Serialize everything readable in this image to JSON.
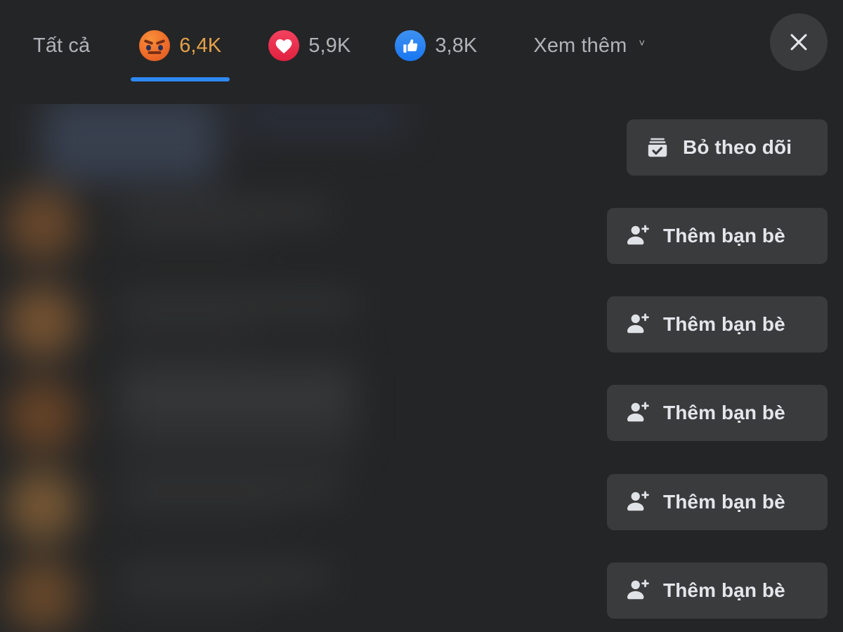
{
  "header": {
    "tabs": [
      {
        "label": "Tất cả",
        "icon": null,
        "active": false,
        "count": null
      },
      {
        "label": "6,4K",
        "icon": "angry-reaction-icon",
        "active": true,
        "count": "6,4K"
      },
      {
        "label": "5,9K",
        "icon": "love-reaction-icon",
        "active": false,
        "count": "5,9K"
      },
      {
        "label": "3,8K",
        "icon": "like-reaction-icon",
        "active": false,
        "count": "3,8K"
      },
      {
        "label": "Xem thêm",
        "icon": "chevron-down-icon",
        "active": false,
        "count": null
      }
    ],
    "more_caret": "˅",
    "close_label": "×",
    "active_tab_color": "#e4a24a",
    "underline_color": "#2e89f5",
    "inactive_tab_color": "#b0b3b8"
  },
  "actions": [
    {
      "label": "Bỏ theo dõi",
      "icon": "unfollow-feed-check-icon"
    },
    {
      "label": "Thêm bạn bè",
      "icon": "person-add-icon"
    },
    {
      "label": "Thêm bạn bè",
      "icon": "person-add-icon"
    },
    {
      "label": "Thêm bạn bè",
      "icon": "person-add-icon"
    },
    {
      "label": "Thêm bạn bè",
      "icon": "person-add-icon"
    },
    {
      "label": "Thêm bạn bè",
      "icon": "person-add-icon"
    }
  ],
  "theme": {
    "background": "#242526",
    "button_background": "#3a3b3c",
    "text_primary": "#e4e6eb",
    "text_secondary": "#b0b3b8",
    "accent_blue": "#2e89f5",
    "angry_orange": "#ef6c2a",
    "love_red": "#e0213f",
    "like_blue": "#1877f2"
  }
}
